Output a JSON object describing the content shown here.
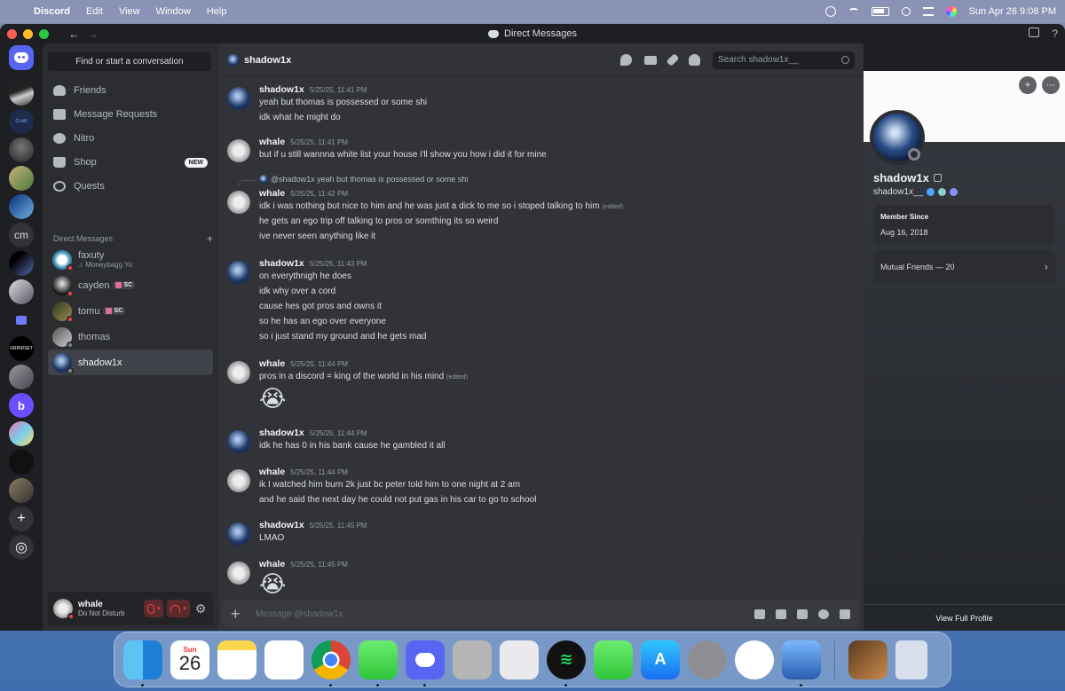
{
  "menubar": {
    "app": "Discord",
    "menus": [
      "Edit",
      "View",
      "Window",
      "Help"
    ],
    "clock": "Sun Apr 26  9:08 PM"
  },
  "window": {
    "title": "Direct Messages"
  },
  "servers": {
    "text_server": "cm",
    "grindset": "GRINDSET",
    "clan": "CLAN"
  },
  "sidebar": {
    "find_placeholder": "Find or start a conversation",
    "nav": [
      {
        "label": "Friends"
      },
      {
        "label": "Message Requests"
      },
      {
        "label": "Nitro"
      },
      {
        "label": "Shop",
        "badge": "NEW"
      },
      {
        "label": "Quests"
      }
    ],
    "dm_header": "Direct Messages",
    "dm_add": "+",
    "dms": [
      {
        "name": "faxuty",
        "sub": "Moneybagg Yo"
      },
      {
        "name": "cayden",
        "tag": "SC"
      },
      {
        "name": "tomu",
        "tag": "SC"
      },
      {
        "name": "thomas"
      },
      {
        "name": "shadow1x"
      }
    ]
  },
  "user_panel": {
    "name": "whale",
    "status": "Do Not Disturb"
  },
  "chat": {
    "header_name": "shadow1x",
    "search_placeholder": "Search shadow1x__",
    "composer_placeholder": "Message @shadow1x",
    "messages": [
      {
        "author": "shadow1x",
        "time": "5/25/25, 11:41 PM",
        "lines": [
          "yeah but thomas is possessed or some shi",
          "idk what he might do"
        ]
      },
      {
        "author": "whale",
        "time": "5/25/25, 11:41 PM",
        "lines": [
          "but if u still wannna  white list your house i'll show you how i did it for mine"
        ]
      },
      {
        "author": "whale",
        "time": "5/25/25, 11:42 PM",
        "reply": "@shadow1x yeah but thomas is possessed or some shi",
        "lines": [
          "idk i was nothing but nice to him and he was just a  dick to me so i stoped talking to him",
          "he gets an ego trip off talking to pros or somthing its so weird",
          "ive never seen anything like it"
        ],
        "edited": "(edited)"
      },
      {
        "author": "shadow1x",
        "time": "5/25/25, 11:43 PM",
        "lines": [
          "on everythnigh he does",
          "idk why over a cord",
          "cause hes got pros and owns it",
          "so he has an ego over everyone",
          "so i just stand my ground and he gets mad"
        ]
      },
      {
        "author": "whale",
        "time": "5/25/25, 11:44 PM",
        "lines": [
          "pros in a discord = king of the world in his mind"
        ],
        "edited": "(edited)",
        "emoji": "😭"
      },
      {
        "author": "shadow1x",
        "time": "5/25/25, 11:44 PM",
        "lines": [
          "idk he has 0 in his bank cause he gambled it all"
        ]
      },
      {
        "author": "whale",
        "time": "5/25/25, 11:44 PM",
        "lines": [
          "ik I watched him burn 2k just bc peter told him to one night at 2 am",
          "and he said the next day he could not put gas in his car to go to school"
        ]
      },
      {
        "author": "shadow1x",
        "time": "5/25/25, 11:45 PM",
        "lines": [
          "LMAO"
        ]
      },
      {
        "author": "whale",
        "time": "5/25/25, 11:45 PM",
        "lines": [],
        "emoji": "😭"
      }
    ]
  },
  "profile": {
    "display_name": "shadow1x",
    "username": "shadow1x__",
    "member_since_label": "Member Since",
    "member_since": "Aug 16, 2018",
    "mutual_friends": "Mutual Friends — 20",
    "view_full": "View Full Profile"
  },
  "dock": {
    "calendar_month": "Sun",
    "calendar_day": "26"
  },
  "colors": {
    "blurple": "#5865f2",
    "dnd_red": "#f23f43",
    "chat_bg": "#313338",
    "sidebar_bg": "#2b2d31"
  }
}
